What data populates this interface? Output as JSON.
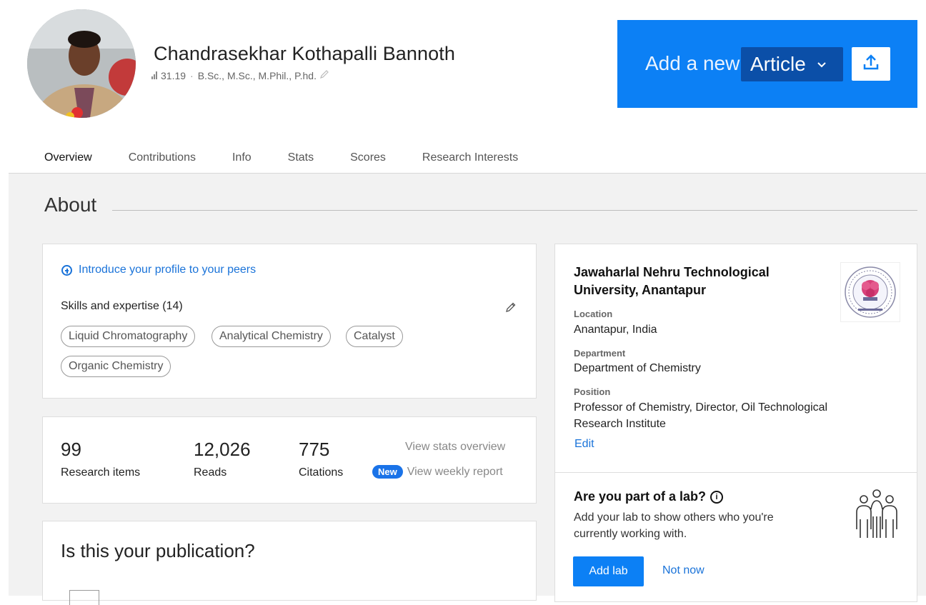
{
  "profile": {
    "name": "Chandrasekhar Kothapalli Bannoth",
    "score": "31.19",
    "degrees": "B.Sc., M.Sc., M.Phil., P.hd."
  },
  "add_banner": {
    "prefix": "Add a new",
    "type_selected": "Article"
  },
  "tabs": [
    {
      "label": "Overview"
    },
    {
      "label": "Contributions"
    },
    {
      "label": "Info"
    },
    {
      "label": "Stats"
    },
    {
      "label": "Scores"
    },
    {
      "label": "Research Interests"
    }
  ],
  "about": {
    "title": "About",
    "intro_link": "Introduce your profile to your peers",
    "skills_title": "Skills and expertise (14)",
    "skills": [
      "Liquid Chromatography",
      "Analytical Chemistry",
      "Catalyst",
      "Organic Chemistry"
    ]
  },
  "stats": {
    "research_items_value": "99",
    "research_items_label": "Research items",
    "reads_value": "12,026",
    "reads_label": "Reads",
    "citations_value": "775",
    "citations_label": "Citations",
    "view_stats": "View stats overview",
    "new_badge": "New",
    "view_weekly": "View weekly report"
  },
  "publication": {
    "title": "Is this your publication?"
  },
  "institution": {
    "name": "Jawaharlal Nehru Technological University, Anantapur",
    "location_label": "Location",
    "location": "Anantapur, India",
    "department_label": "Department",
    "department": "Department of Chemistry",
    "position_label": "Position",
    "position": "Professor of Chemistry, Director, Oil Technological Research Institute",
    "edit": "Edit"
  },
  "lab": {
    "title": "Are you part of a lab?",
    "description": "Add your lab to show others who you're currently working with.",
    "add_button": "Add lab",
    "not_now": "Not now"
  },
  "colors": {
    "brand_blue": "#0c80f5",
    "select_dark_blue": "#0b4fa8",
    "link_blue": "#1a73d9",
    "content_gray": "#f2f2f2"
  },
  "icons": [
    "score-bars-icon",
    "pencil-icon",
    "chevron-down-icon",
    "upload-icon",
    "plus-circle-icon",
    "info-icon",
    "lab-people-icon",
    "institution-logo"
  ]
}
